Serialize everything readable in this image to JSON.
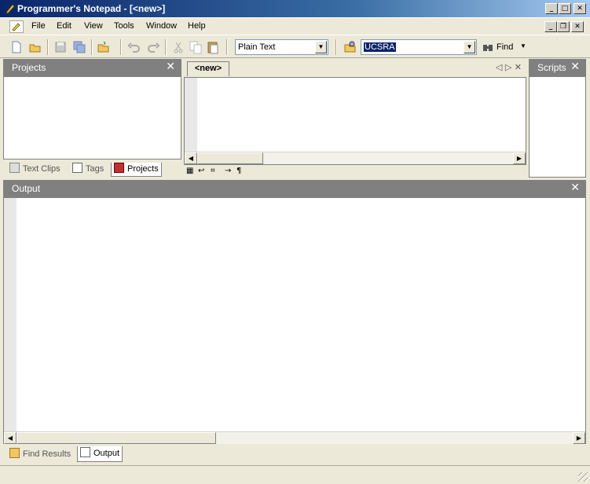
{
  "window": {
    "title": "Programmer's Notepad - [<new>]"
  },
  "menu": {
    "items": [
      "File",
      "Edit",
      "View",
      "Tools",
      "Window",
      "Help"
    ]
  },
  "toolbar": {
    "scheme_select": {
      "value": "Plain Text"
    },
    "find_combo": {
      "value": "UCSRA"
    },
    "find_label": "Find"
  },
  "panels": {
    "projects": {
      "title": "Projects",
      "tabs": [
        "Text Clips",
        "Tags",
        "Projects"
      ]
    },
    "scripts": {
      "title": "Scripts"
    },
    "output": {
      "title": "Output"
    }
  },
  "editor": {
    "tab_label": "<new>"
  },
  "bottom_tabs": [
    "Find Results",
    "Output"
  ],
  "colors": {
    "panel_header": "#808080",
    "title_start": "#0a246a",
    "title_end": "#a6caf0",
    "selection": "#0a246a"
  }
}
